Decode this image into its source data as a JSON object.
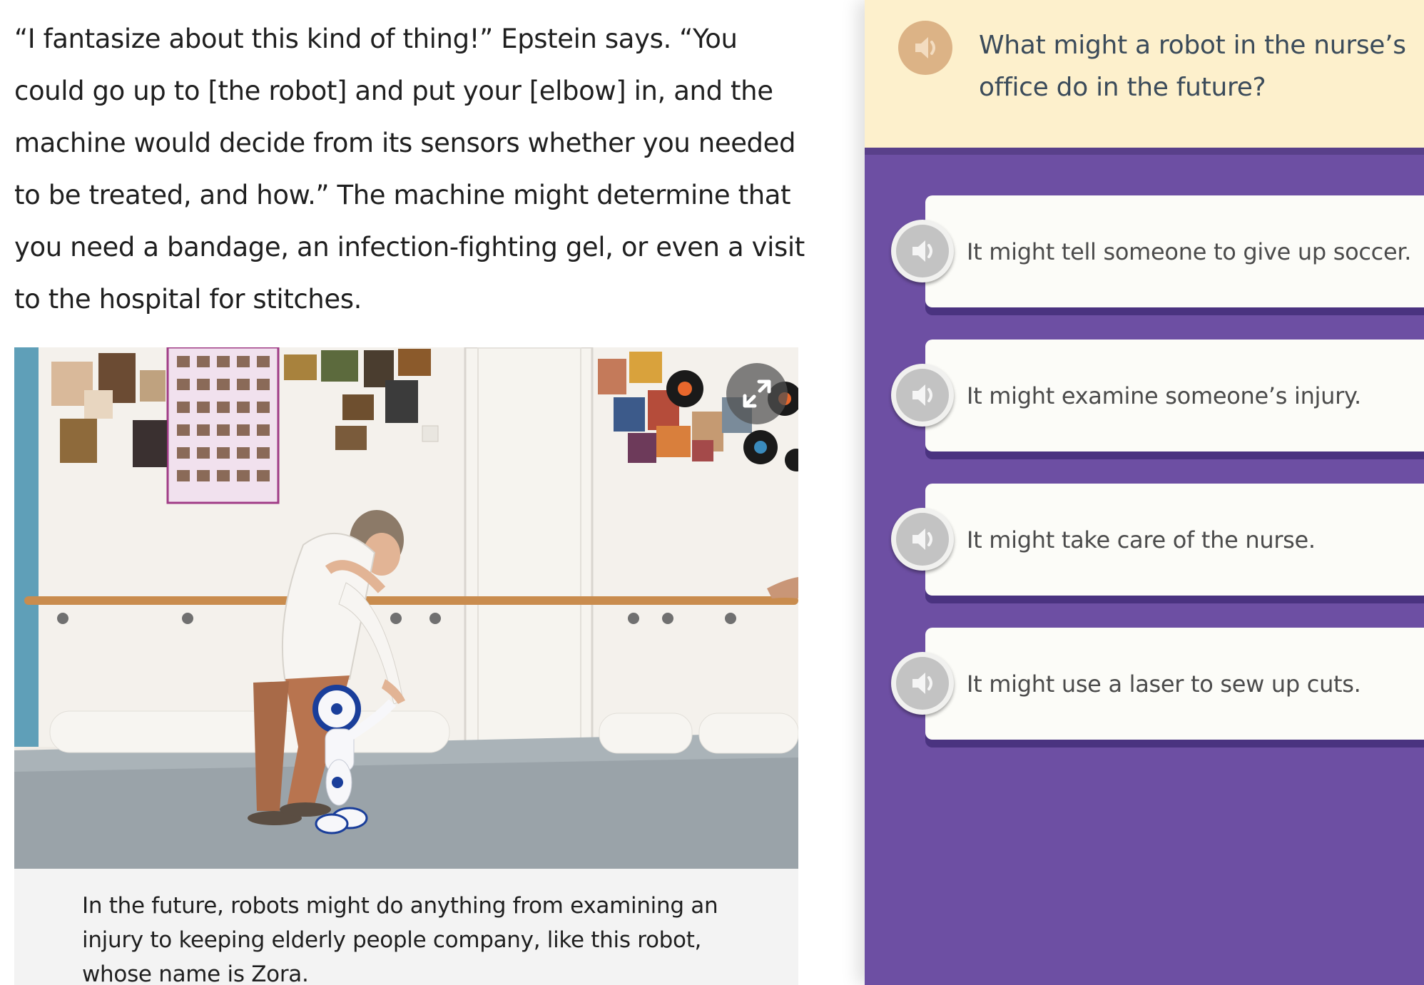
{
  "article": {
    "paragraph": "“I fantasize about this kind of thing!” Epstein says. “You could go up to [the robot] and put your [elbow] in, and the machine would decide from its sensors whether you needed to be treated, and how.” The machine might determine that you need a bandage, an infection-fighting gel, or even a visit to the hospital for stitches.",
    "photo_caption": "In the future, robots might do anything from examining an injury to keeping elderly people company, like this robot, whose name is Zora.",
    "expand_icon": "expand-arrows-icon"
  },
  "quiz": {
    "question": "What might a robot in the nurse’s office do in the future?",
    "speaker_icon": "speaker-icon",
    "answers": [
      {
        "label": "It might tell someone to give up soccer."
      },
      {
        "label": "It might examine someone’s injury."
      },
      {
        "label": "It might take care of the nurse."
      },
      {
        "label": "It might use a laser to sew up cuts."
      }
    ]
  },
  "colors": {
    "question_background": "#fdf0cc",
    "question_text": "#3b4b5a",
    "question_speaker": "#dcb386",
    "answers_background": "#6d4fa3",
    "answer_card": "#fcfcf8",
    "answer_shadow": "#4a3380",
    "caption_background": "#f3f3f3"
  }
}
